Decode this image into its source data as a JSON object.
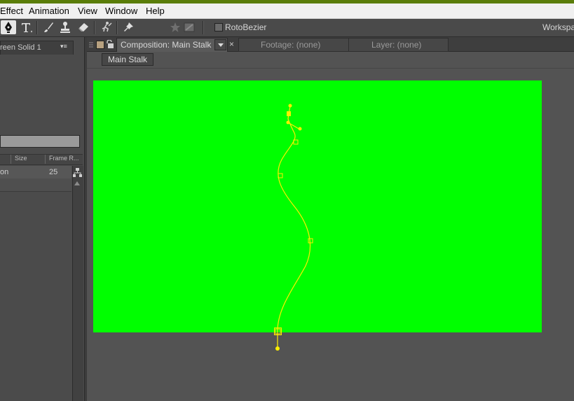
{
  "menubar": {
    "items": [
      "Effect",
      "Animation",
      "View",
      "Window",
      "Help"
    ]
  },
  "toolbar": {
    "tools": [
      "pen-tool",
      "type-tool",
      "brush-tool",
      "clone-stamp-tool",
      "eraser-tool",
      "roto-brush-tool",
      "puppet-pin-tool"
    ],
    "rotobezier_label": "RotoBezier",
    "rotobezier_checked": false,
    "workspace_label": "Workspace"
  },
  "project_panel": {
    "tab_label": "reen Solid 1",
    "columns": [
      "Size",
      "Frame R..."
    ],
    "rows": [
      {
        "name": "on",
        "frame_rate": "25"
      }
    ]
  },
  "composition_panel": {
    "comp_tab_label": "Composition: Main Stalk",
    "footage_tab_label": "Footage: (none)",
    "layer_tab_label": "Layer: (none)",
    "close_glyph": "×",
    "breadcrumb": "Main Stalk",
    "canvas_color": "#00ff00",
    "mask_color": "#ffee00"
  }
}
